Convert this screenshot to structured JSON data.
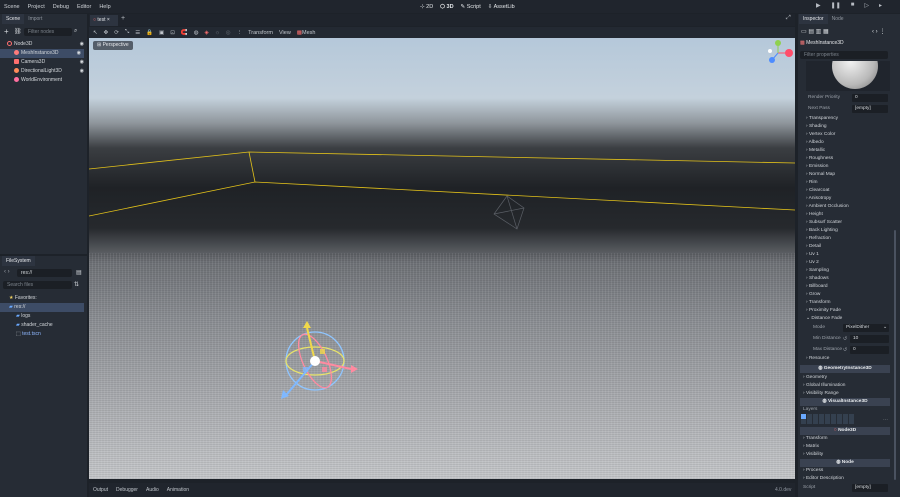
{
  "menu": [
    "Scene",
    "Project",
    "Debug",
    "Editor",
    "Help"
  ],
  "modes": [
    "2D",
    "3D",
    "Script",
    "AssetLib"
  ],
  "scene_dock": {
    "tabs": [
      "Scene",
      "Import"
    ],
    "filter_placeholder": "Filter nodes",
    "nodes": [
      "Node3D",
      "MeshInstance3D",
      "Camera3D",
      "DirectionalLight3D",
      "WorldEnvironment"
    ]
  },
  "fs_dock": {
    "tab": "FileSystem",
    "path": "res://",
    "search_placeholder": "Search files",
    "items": [
      "Favorites:",
      "res://",
      "logs",
      "shader_cache",
      "test.tscn"
    ]
  },
  "editor_tab": "test",
  "viewport": {
    "menus": [
      "Transform",
      "View",
      "Mesh"
    ],
    "perspective": "Perspective"
  },
  "bottom": {
    "items": [
      "Output",
      "Debugger",
      "Audio",
      "Animation"
    ],
    "version": "4.0.dev"
  },
  "inspector": {
    "tabs": [
      "Inspector",
      "Node"
    ],
    "object": "MeshInstance3D",
    "filter_placeholder": "Filter properties",
    "render_priority_label": "Render Priority",
    "render_priority": "0",
    "next_pass_label": "Next Pass",
    "next_pass": "[empty]",
    "sections": [
      "Transparency",
      "Shading",
      "Vertex Color",
      "Albedo",
      "Metallic",
      "Roughness",
      "Emission",
      "Normal Map",
      "Rim",
      "Clearcoat",
      "Anisotropy",
      "Ambient Occlusion",
      "Height",
      "Subsurf Scatter",
      "Back Lighting",
      "Refraction",
      "Detail",
      "Uv 1",
      "Uv 2",
      "Sampling",
      "Shadows",
      "Billboard",
      "Grow",
      "Transform",
      "Proximity Fade",
      "Distance Fade"
    ],
    "mode_label": "Mode",
    "mode": "PixelDither",
    "min_distance_label": "Min Distance",
    "min_distance": "10",
    "max_distance_label": "Max Distance",
    "max_distance": "0",
    "resource": "Resource",
    "geometry_header": "GeometryInstance3D",
    "geo_sections": [
      "Geometry",
      "Global Illumination",
      "Visibility Range"
    ],
    "visual_header": "VisualInstance3D",
    "layers_label": "Layers",
    "node3d_header": "Node3D",
    "node3d_sections": [
      "Transform",
      "Matrix",
      "Visibility"
    ],
    "node_header": "Node",
    "node_sections": [
      "Process",
      "Editor Description"
    ],
    "script_label": "Script",
    "script": "[empty]"
  },
  "colors": {
    "accent": "#6aa9ff",
    "selection": "#3d4c66",
    "guide": "#f0c400"
  }
}
